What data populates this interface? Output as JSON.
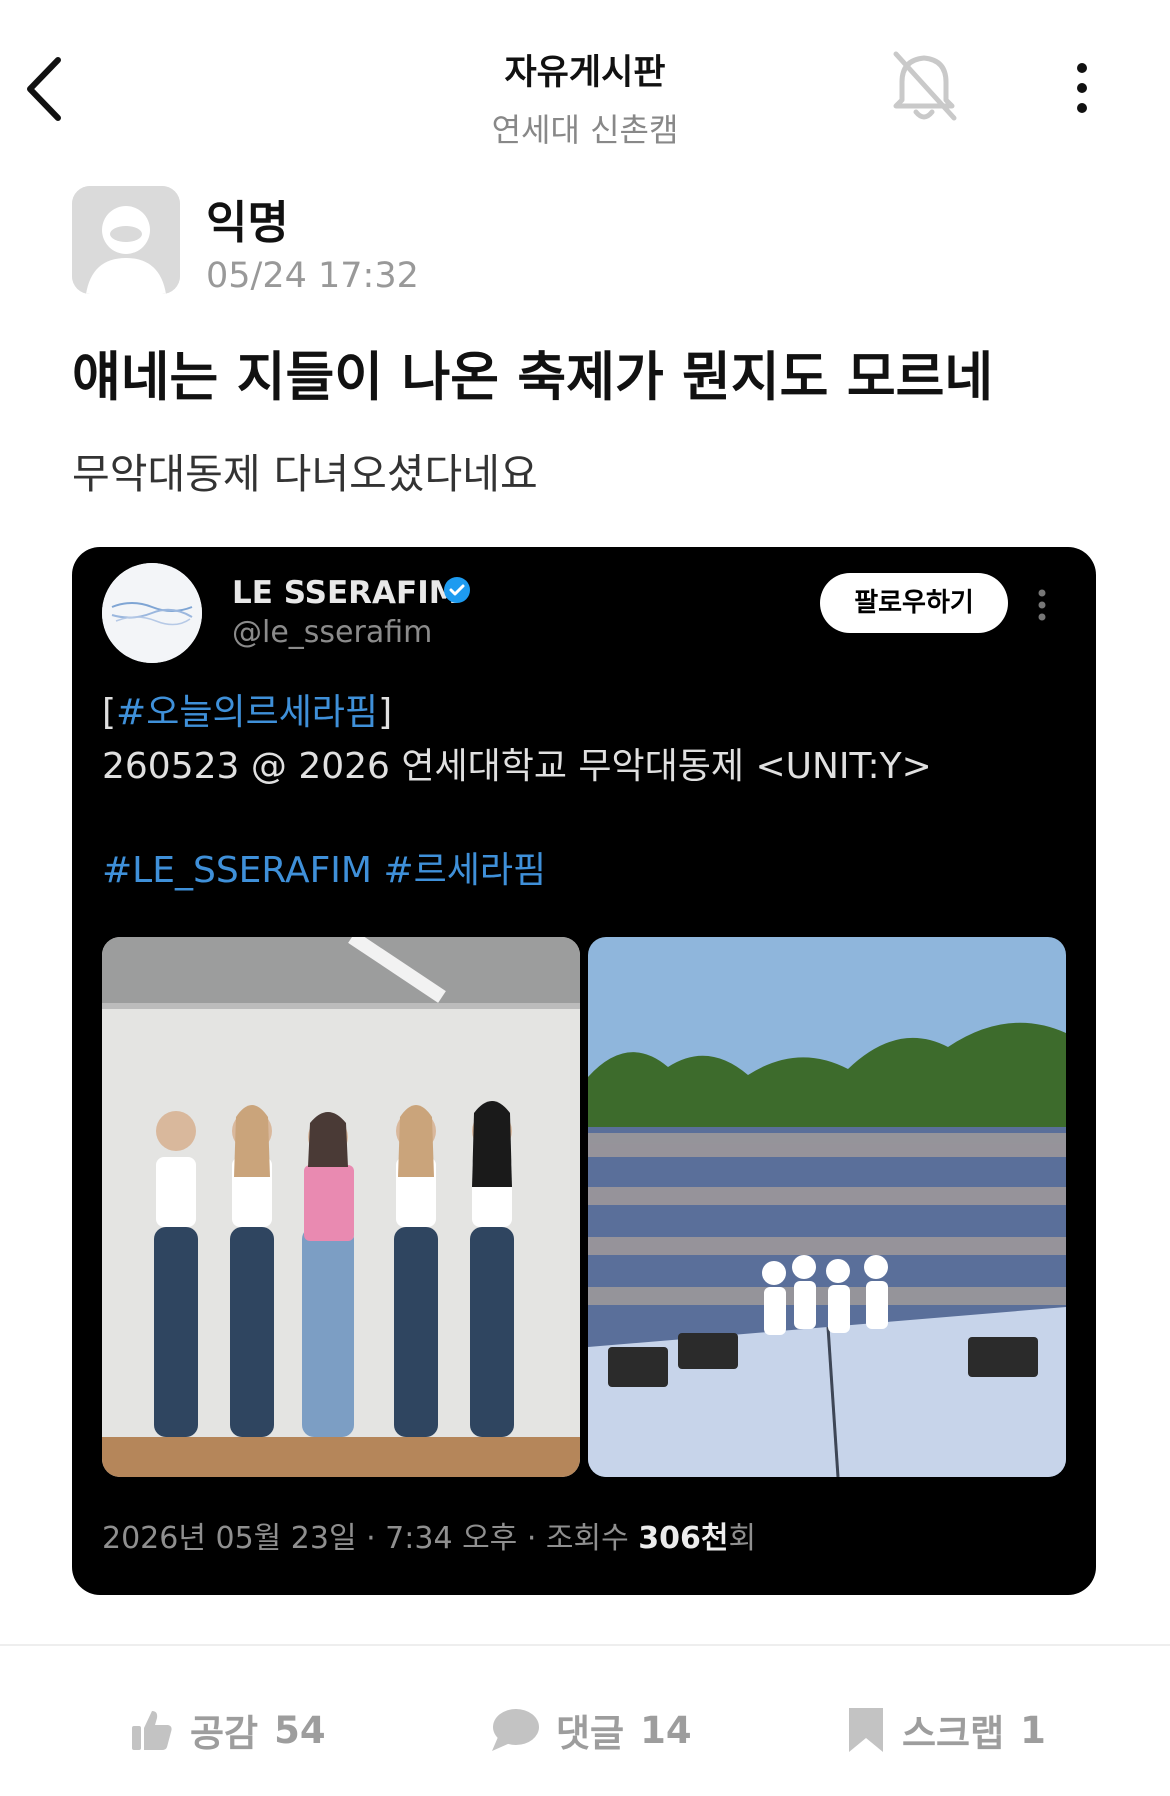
{
  "header": {
    "title": "자유게시판",
    "subtitle": "연세대 신촌캠",
    "icons": [
      "back-chevron-icon",
      "bell-off-icon",
      "more-vertical-icon"
    ]
  },
  "post": {
    "author": "익명",
    "time": "05/24 17:32",
    "title": "얘네는 지들이 나온 축제가 뭔지도 모르네",
    "body": "무악대동제 다녀오셨다네요"
  },
  "tweet": {
    "name": "LE SSERAFIM",
    "handle": "@le_sserafim",
    "follow": "팔로우하기",
    "bracket_open": "[",
    "hashtag1": "#오늘의르세라핌",
    "bracket_close": "]",
    "line2": "260523 @ 2026 연세대학교 무악대동제 <UNIT:Y>",
    "tag_a": "#LE_SSERAFIM",
    "tag_b": "#르세라핌",
    "footer_prefix": "2026년 05월 23일 · 7:34 오후 · 조회수 ",
    "footer_views": "306천",
    "footer_suffix": "회",
    "colors": {
      "link": "#3f90d9",
      "background": "#000000"
    }
  },
  "actions": {
    "like_label": "공감",
    "like_count": "54",
    "comment_label": "댓글",
    "comment_count": "14",
    "scrap_label": "스크랩",
    "scrap_count": "1"
  }
}
